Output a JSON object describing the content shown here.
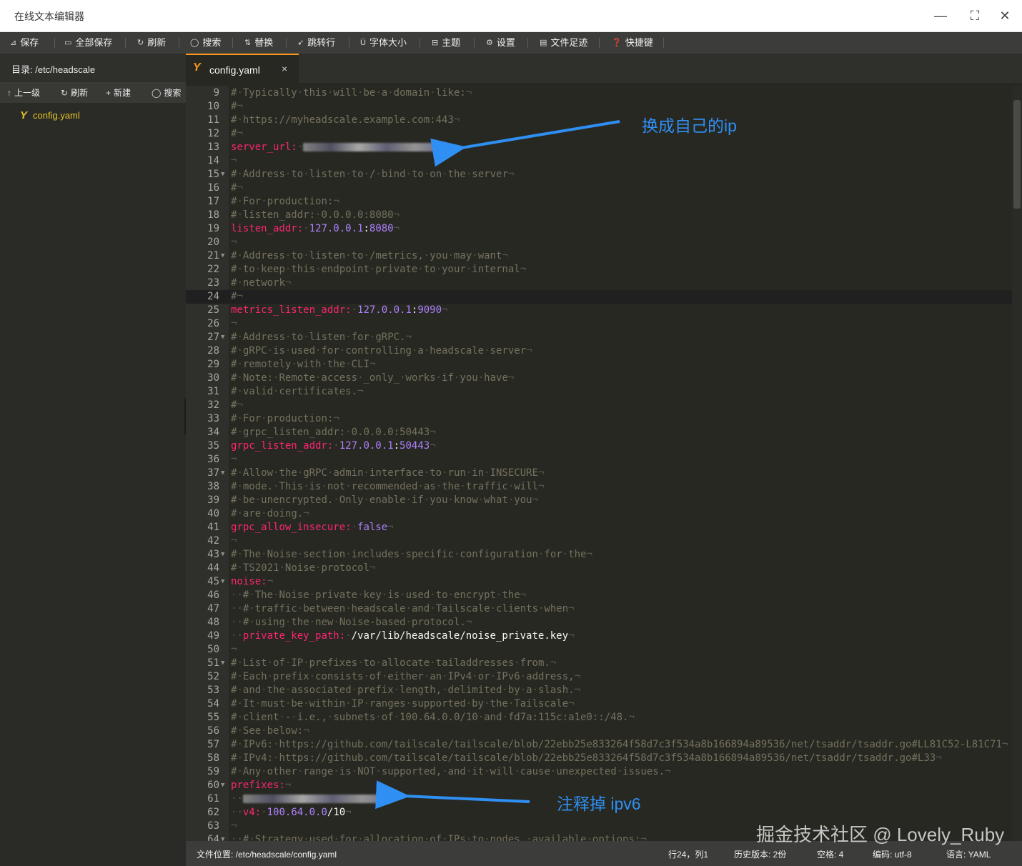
{
  "window": {
    "title": "在线文本编辑器",
    "minimize_icon": "minimize-icon",
    "maximize_icon": "maximize-icon",
    "close_icon": "close-icon"
  },
  "toolbar": [
    {
      "icon": "save-icon",
      "glyph": "⊿",
      "label": "保存"
    },
    {
      "icon": "save-all-icon",
      "glyph": "▭",
      "label": "全部保存"
    },
    {
      "icon": "refresh-icon",
      "glyph": "↻",
      "label": "刷新"
    },
    {
      "icon": "search-icon",
      "glyph": "◯",
      "label": "搜索"
    },
    {
      "icon": "replace-icon",
      "glyph": "⇅",
      "label": "替换"
    },
    {
      "icon": "goto-line-icon",
      "glyph": "➶",
      "label": "跳转行"
    },
    {
      "icon": "font-size-icon",
      "glyph": "Ü",
      "label": "字体大小"
    },
    {
      "icon": "theme-icon",
      "glyph": "⊟",
      "label": "主题"
    },
    {
      "icon": "settings-icon",
      "glyph": "⚙",
      "label": "设置"
    },
    {
      "icon": "file-history-icon",
      "glyph": "▤",
      "label": "文件足迹"
    },
    {
      "icon": "shortcut-icon",
      "glyph": "❓",
      "label": "快捷键"
    }
  ],
  "sidebar": {
    "directory_label": "目录: /etc/headscale",
    "actions": [
      {
        "icon": "up-arrow-icon",
        "glyph": "↑",
        "label": "上一级"
      },
      {
        "icon": "refresh-icon",
        "glyph": "↻",
        "label": "刷新"
      },
      {
        "icon": "plus-icon",
        "glyph": "+",
        "label": "新建"
      },
      {
        "icon": "search-icon",
        "glyph": "◯",
        "label": "搜索"
      }
    ],
    "files": [
      {
        "name": "config.yaml",
        "icon": "yaml-icon"
      }
    ]
  },
  "tab": {
    "name": "config.yaml",
    "icon": "yaml-icon",
    "close_glyph": "×"
  },
  "editor": {
    "active_line": 24,
    "lines": [
      {
        "n": 9,
        "t": "c",
        "text": "# Typically this will be a domain like:"
      },
      {
        "n": 10,
        "t": "c",
        "text": "#"
      },
      {
        "n": 11,
        "t": "c",
        "text": "# https://myheadscale.example.com:443"
      },
      {
        "n": 12,
        "t": "c",
        "text": "#"
      },
      {
        "n": 13,
        "t": "kv",
        "key": "server_url:",
        "blurred": true
      },
      {
        "n": 14,
        "t": "e"
      },
      {
        "n": 15,
        "t": "c",
        "fold": true,
        "text": "# Address to listen to / bind to on the server"
      },
      {
        "n": 16,
        "t": "c",
        "text": "#"
      },
      {
        "n": 17,
        "t": "c",
        "text": "# For production:"
      },
      {
        "n": 18,
        "t": "c",
        "text": "# listen_addr: 0.0.0.0:8080"
      },
      {
        "n": 19,
        "t": "kv",
        "key": "listen_addr:",
        "parts": [
          [
            "num",
            "127.0.0.1"
          ],
          [
            "str",
            ":"
          ],
          [
            "num",
            "8080"
          ]
        ]
      },
      {
        "n": 20,
        "t": "e"
      },
      {
        "n": 21,
        "t": "c",
        "fold": true,
        "text": "# Address to listen to /metrics, you may want"
      },
      {
        "n": 22,
        "t": "c",
        "text": "# to keep this endpoint private to your internal"
      },
      {
        "n": 23,
        "t": "c",
        "text": "# network"
      },
      {
        "n": 24,
        "t": "c",
        "text": "#"
      },
      {
        "n": 25,
        "t": "kv",
        "key": "metrics_listen_addr:",
        "parts": [
          [
            "num",
            "127.0.0.1"
          ],
          [
            "str",
            ":"
          ],
          [
            "num",
            "9090"
          ]
        ]
      },
      {
        "n": 26,
        "t": "e"
      },
      {
        "n": 27,
        "t": "c",
        "fold": true,
        "text": "# Address to listen for gRPC."
      },
      {
        "n": 28,
        "t": "c",
        "text": "# gRPC is used for controlling a headscale server"
      },
      {
        "n": 29,
        "t": "c",
        "text": "# remotely with the CLI"
      },
      {
        "n": 30,
        "t": "c",
        "text": "# Note: Remote access _only_ works if you have"
      },
      {
        "n": 31,
        "t": "c",
        "text": "# valid certificates."
      },
      {
        "n": 32,
        "t": "c",
        "text": "#"
      },
      {
        "n": 33,
        "t": "c",
        "text": "# For production:"
      },
      {
        "n": 34,
        "t": "c",
        "text": "# grpc_listen_addr: 0.0.0.0:50443"
      },
      {
        "n": 35,
        "t": "kv",
        "key": "grpc_listen_addr:",
        "parts": [
          [
            "num",
            "127.0.0.1"
          ],
          [
            "str",
            ":"
          ],
          [
            "num",
            "50443"
          ]
        ]
      },
      {
        "n": 36,
        "t": "e"
      },
      {
        "n": 37,
        "t": "c",
        "fold": true,
        "text": "# Allow the gRPC admin interface to run in INSECURE"
      },
      {
        "n": 38,
        "t": "c",
        "text": "# mode. This is not recommended as the traffic will"
      },
      {
        "n": 39,
        "t": "c",
        "text": "# be unencrypted. Only enable if you know what you"
      },
      {
        "n": 40,
        "t": "c",
        "text": "# are doing."
      },
      {
        "n": 41,
        "t": "kv",
        "key": "grpc_allow_insecure:",
        "parts": [
          [
            "bool",
            "false"
          ]
        ]
      },
      {
        "n": 42,
        "t": "e"
      },
      {
        "n": 43,
        "t": "c",
        "fold": true,
        "text": "# The Noise section includes specific configuration for the"
      },
      {
        "n": 44,
        "t": "c",
        "text": "# TS2021 Noise protocol"
      },
      {
        "n": 45,
        "t": "kv",
        "fold": true,
        "key": "noise:",
        "parts": []
      },
      {
        "n": 46,
        "t": "c",
        "indent": "  ",
        "text": "# The Noise private key is used to encrypt the"
      },
      {
        "n": 47,
        "t": "c",
        "indent": "  ",
        "text": "# traffic between headscale and Tailscale clients when"
      },
      {
        "n": 48,
        "t": "c",
        "indent": "  ",
        "text": "# using the new Noise-based protocol."
      },
      {
        "n": 49,
        "t": "kv",
        "indent": "  ",
        "key": "private_key_path:",
        "parts": [
          [
            "str",
            "/var/lib/headscale/noise_private.key"
          ]
        ]
      },
      {
        "n": 50,
        "t": "e"
      },
      {
        "n": 51,
        "t": "c",
        "fold": true,
        "text": "# List of IP prefixes to allocate tailaddresses from."
      },
      {
        "n": 52,
        "t": "c",
        "text": "# Each prefix consists of either an IPv4 or IPv6 address,"
      },
      {
        "n": 53,
        "t": "c",
        "text": "# and the associated prefix length, delimited by a slash."
      },
      {
        "n": 54,
        "t": "c",
        "text": "# It must be within IP ranges supported by the Tailscale"
      },
      {
        "n": 55,
        "t": "c",
        "text": "# client - i.e., subnets of 100.64.0.0/10 and fd7a:115c:a1e0::/48."
      },
      {
        "n": 56,
        "t": "c",
        "text": "# See below:"
      },
      {
        "n": 57,
        "t": "c",
        "text": "# IPv6: https://github.com/tailscale/tailscale/blob/22ebb25e833264f58d7c3f534a8b166894a89536/net/tsaddr/tsaddr.go#LL81C52-L81C71"
      },
      {
        "n": 58,
        "t": "c",
        "text": "# IPv4: https://github.com/tailscale/tailscale/blob/22ebb25e833264f58d7c3f534a8b166894a89536/net/tsaddr/tsaddr.go#L33"
      },
      {
        "n": 59,
        "t": "c",
        "text": "# Any other range is NOT supported, and it will cause unexpected issues."
      },
      {
        "n": 60,
        "t": "kv",
        "fold": true,
        "key": "prefixes:",
        "parts": []
      },
      {
        "n": 61,
        "t": "blur",
        "indent": "  "
      },
      {
        "n": 62,
        "t": "kv",
        "indent": "  ",
        "key": "v4:",
        "parts": [
          [
            "num",
            "100.64.0.0"
          ],
          [
            "str",
            "/10"
          ]
        ]
      },
      {
        "n": 63,
        "t": "e"
      },
      {
        "n": 64,
        "t": "c",
        "fold": true,
        "indent": "  ",
        "text": "# Strategy used for allocation of IPs to nodes, available options:"
      }
    ]
  },
  "annotations": {
    "server_url_note": "换成自己的ip",
    "ipv6_note": "注释掉 ipv6",
    "watermark": "掘金技术社区 @ Lovely_Ruby",
    "arrow_color": "#2f8ff3"
  },
  "status": {
    "file_path": "文件位置: /etc/headscale/config.yaml",
    "cursor": "行24，列1",
    "history": "历史版本: 2份",
    "indent": "空格: 4",
    "encoding": "编码: utf-8",
    "language": "语言: YAML"
  }
}
